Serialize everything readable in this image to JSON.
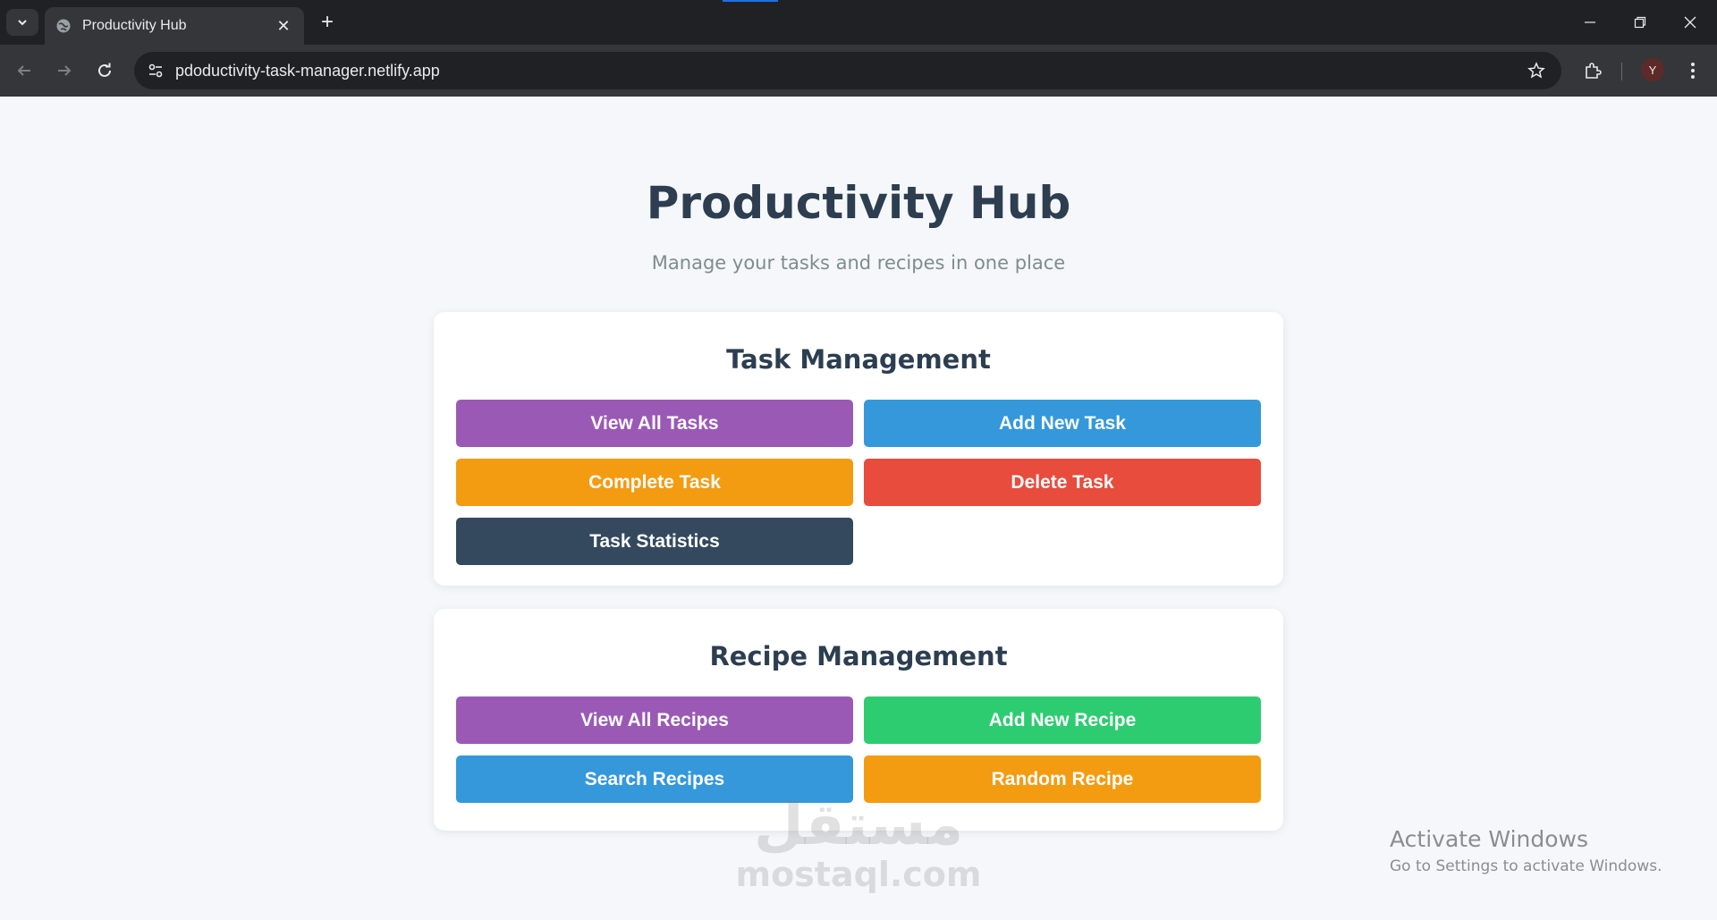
{
  "browser": {
    "tab_title": "Productivity Hub",
    "url": "pdoductivity-task-manager.netlify.app",
    "profile_initial": "Y"
  },
  "page": {
    "title": "Productivity Hub",
    "subtitle": "Manage your tasks and recipes in one place"
  },
  "task_section": {
    "heading": "Task Management",
    "buttons": [
      {
        "label": "View All Tasks",
        "color": "#9b59b6"
      },
      {
        "label": "Add New Task",
        "color": "#3498db"
      },
      {
        "label": "Complete Task",
        "color": "#f39c12"
      },
      {
        "label": "Delete Task",
        "color": "#e74c3c"
      },
      {
        "label": "Task Statistics",
        "color": "#34495e"
      }
    ]
  },
  "recipe_section": {
    "heading": "Recipe Management",
    "buttons": [
      {
        "label": "View All Recipes",
        "color": "#9b59b6"
      },
      {
        "label": "Add New Recipe",
        "color": "#2ecc71"
      },
      {
        "label": "Search Recipes",
        "color": "#3498db"
      },
      {
        "label": "Random Recipe",
        "color": "#f39c12"
      }
    ]
  },
  "watermark": {
    "arabic": "مستقل",
    "english": "mostaql.com"
  },
  "windows_activation": {
    "line1": "Activate Windows",
    "line2": "Go to Settings to activate Windows."
  }
}
